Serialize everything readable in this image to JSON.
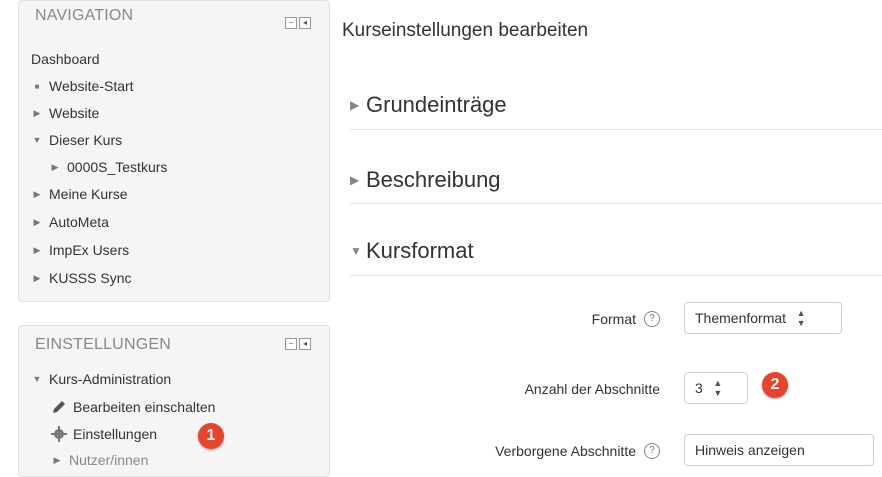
{
  "navigation": {
    "title": "NAVIGATION",
    "items": [
      {
        "label": "Dashboard",
        "marker": ""
      },
      {
        "label": "Website-Start",
        "marker": "■"
      },
      {
        "label": "Website",
        "marker": "▶"
      },
      {
        "label": "Dieser Kurs",
        "marker": "▼"
      },
      {
        "label": "0000S_Testkurs",
        "marker": "▶"
      },
      {
        "label": "Meine Kurse",
        "marker": "▶"
      },
      {
        "label": "AutoMeta",
        "marker": "▶"
      },
      {
        "label": "ImpEx Users",
        "marker": "▶"
      },
      {
        "label": "KUSSS Sync",
        "marker": "▶"
      }
    ]
  },
  "settings": {
    "title": "EINSTELLUNGEN",
    "items": [
      {
        "label": "Kurs-Administration",
        "marker": "▼"
      },
      {
        "label": "Bearbeiten einschalten",
        "icon": "pencil-icon"
      },
      {
        "label": "Einstellungen",
        "icon": "gear-icon"
      },
      {
        "label": "Nutzer/innen",
        "marker": "▶"
      }
    ]
  },
  "block_controls": {
    "collapse": "−",
    "dock": "◂"
  },
  "main": {
    "page_title": "Kurseinstellungen bearbeiten",
    "sections": [
      {
        "label": "Grundeinträge",
        "caret": "▶"
      },
      {
        "label": "Beschreibung",
        "caret": "▶"
      },
      {
        "label": "Kursformat",
        "caret": "▼"
      }
    ],
    "form": {
      "format_label": "Format",
      "format_value": "Themenformat",
      "sections_count_label": "Anzahl der Abschnitte",
      "sections_count_value": "3",
      "hidden_sections_label": "Verborgene Abschnitte",
      "hidden_sections_value": "Hinweis anzeigen"
    }
  },
  "callouts": {
    "one": "1",
    "two": "2"
  },
  "help_glyph": "?",
  "select_arrows": "▲▼",
  "colors": {
    "callout": "#e8432d",
    "block_bg": "#f5f5f5"
  }
}
